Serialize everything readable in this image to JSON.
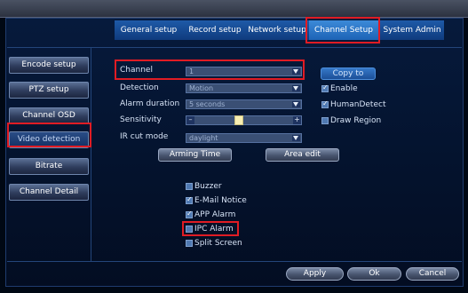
{
  "tabs": {
    "general": "General setup",
    "record": "Record setup",
    "network": "Network setup",
    "channel": "Channel Setup",
    "system": "System Admin"
  },
  "sidebar": {
    "encode": "Encode setup",
    "ptz": "PTZ setup",
    "osd": "Channel OSD",
    "video_detection": "Video detection",
    "bitrate": "Bitrate",
    "channel_detail": "Channel Detail"
  },
  "form": {
    "channel_label": "Channel",
    "channel_value": "1",
    "detection_label": "Detection",
    "detection_value": "Motion",
    "alarm_duration_label": "Alarm duration",
    "alarm_duration_value": "5 seconds",
    "sensitivity_label": "Sensitivity",
    "sensitivity_level": 0.45,
    "ir_cut_label": "IR cut mode",
    "ir_cut_value": "daylight"
  },
  "right_options": {
    "copy_to": "Copy to",
    "enable": "Enable",
    "enable_checked": true,
    "human_detect": "HumanDetect",
    "human_detect_checked": true,
    "draw_region": "Draw Region",
    "draw_region_checked": false
  },
  "actions": {
    "arming_time": "Arming Time",
    "area_edit": "Area edit"
  },
  "alarm_options": {
    "buzzer": "Buzzer",
    "buzzer_checked": false,
    "email": "E-Mail Notice",
    "email_checked": true,
    "app": "APP Alarm",
    "app_checked": true,
    "ipc": "IPC Alarm",
    "ipc_checked": false,
    "split": "Split Screen",
    "split_checked": false
  },
  "footer": {
    "apply": "Apply",
    "ok": "Ok",
    "cancel": "Cancel"
  },
  "colors": {
    "highlight": "#e01c24",
    "accent": "#1d63b6"
  }
}
